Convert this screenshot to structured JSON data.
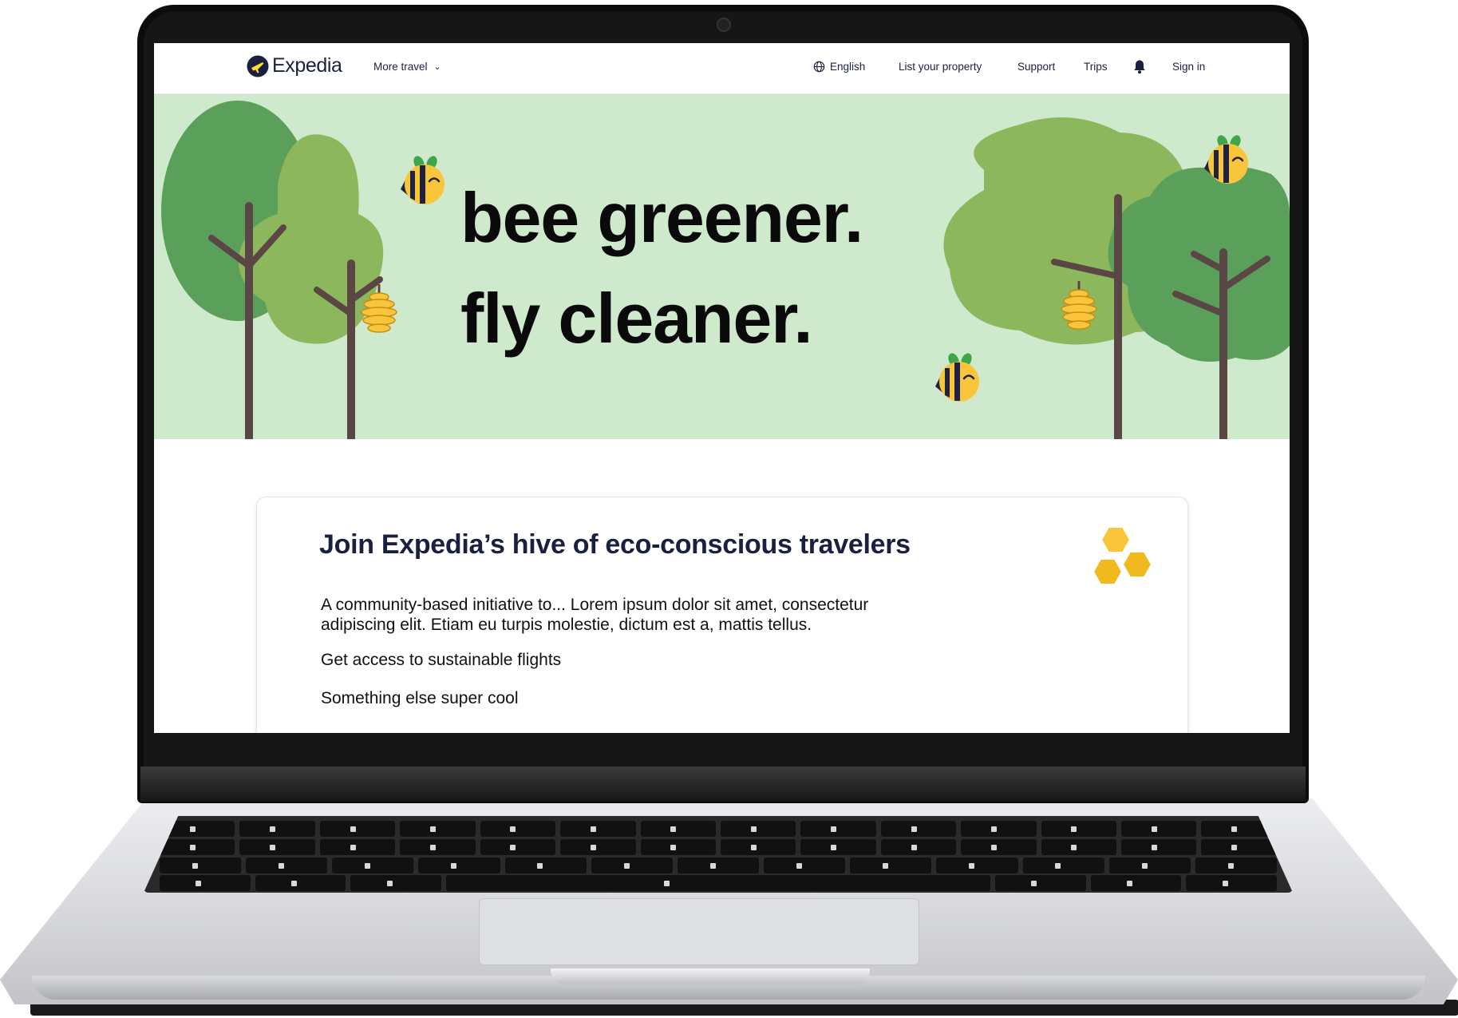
{
  "nav": {
    "logo_text": "Expedia",
    "more_travel": "More travel",
    "language": "English",
    "list_property": "List your property",
    "support": "Support",
    "trips": "Trips",
    "sign_in": "Sign in"
  },
  "hero": {
    "line1": "bee greener.",
    "line2": "fly cleaner."
  },
  "card": {
    "title": "Join Expedia’s hive of eco-conscious travelers",
    "body": "A community-based initiative to... Lorem ipsum dolor sit amet, consectetur adipiscing elit. Etiam eu turpis molestie, dictum est a, mattis tellus.",
    "item1": "Get access to sustainable flights",
    "item2": "Something else super cool"
  },
  "colors": {
    "hero_bg": "#cfe9cd",
    "tree_dark": "#5ba05a",
    "tree_light": "#8db75c",
    "trunk": "#5a4645",
    "bee_yellow": "#f9c53a",
    "navy": "#1b2040"
  },
  "icons": [
    "expedia-logo-icon",
    "chevron-down-icon",
    "globe-icon",
    "bell-icon",
    "bee-icon",
    "beehive-icon",
    "tree-icon",
    "honeycomb-icon"
  ]
}
